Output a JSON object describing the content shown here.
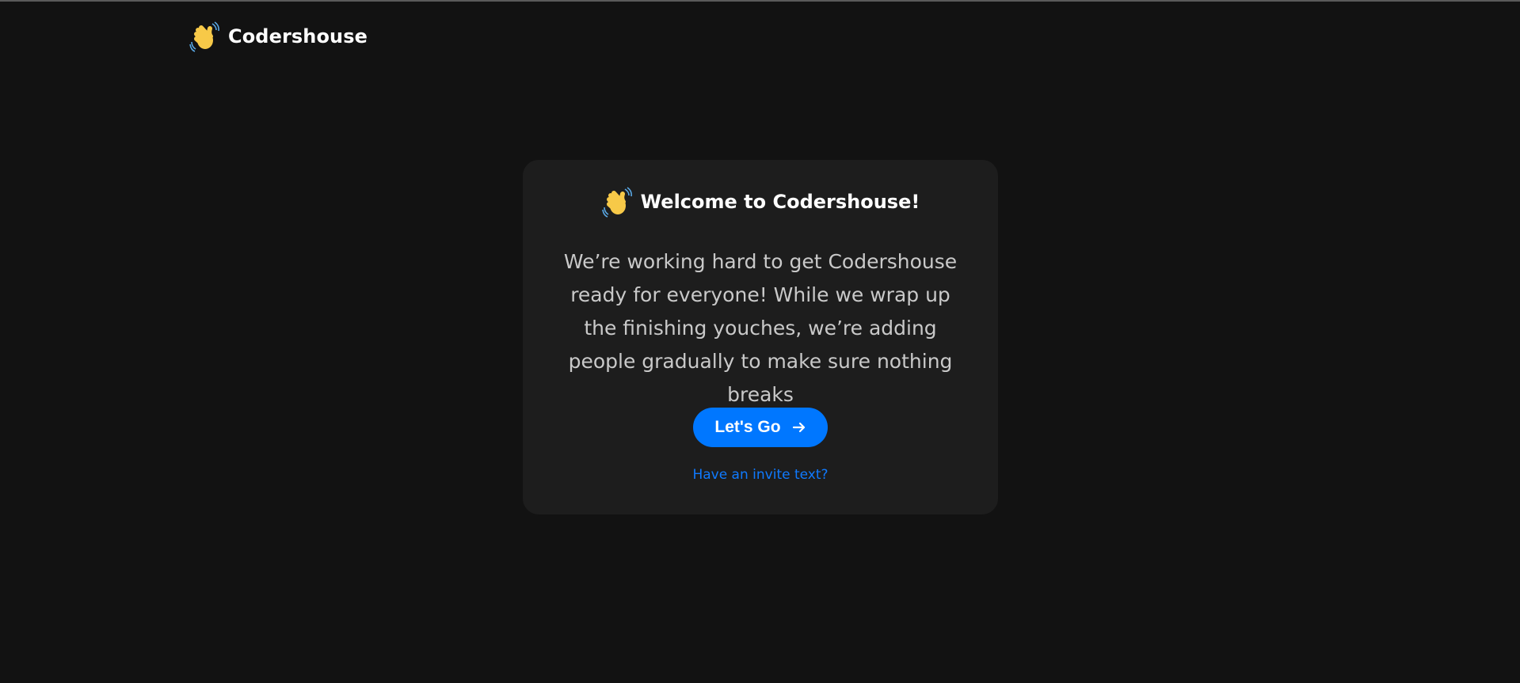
{
  "navbar": {
    "brand": "Codershouse",
    "logo_icon": "waving-hand-icon"
  },
  "card": {
    "heading_icon": "waving-hand-icon",
    "title": "Welcome to Codershouse!",
    "body": "We’re working hard to get Codershouse ready for everyone! While we wrap up the finishing youches, we’re adding people gradually to make sure nothing breaks",
    "cta_label": "Let's Go",
    "cta_icon": "arrow-right-icon",
    "invite_link": "Have an invite text?"
  },
  "colors": {
    "background": "#121212",
    "card": "#1d1d1d",
    "accent": "#0077ff",
    "link": "#0f7aff",
    "body_text": "#c9c9c9"
  }
}
